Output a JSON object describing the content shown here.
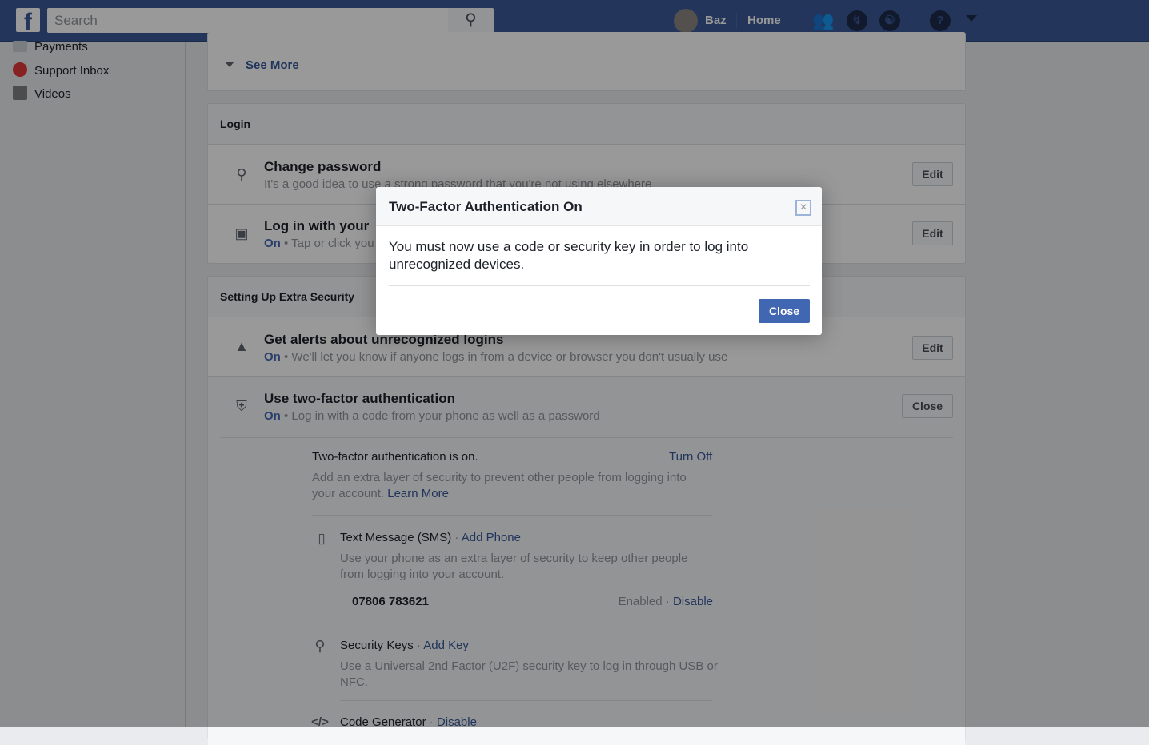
{
  "topbar": {
    "search_placeholder": "Search",
    "user": "Baz",
    "home": "Home",
    "icons": [
      "friends-icon",
      "messenger-icon",
      "globe-icon",
      "help-icon",
      "caret-down-icon"
    ]
  },
  "sidebar": {
    "items": [
      {
        "label": "Payments",
        "icon": "credit-card-icon"
      },
      {
        "label": "Support Inbox",
        "icon": "lifebuoy-icon"
      },
      {
        "label": "Videos",
        "icon": "film-icon"
      }
    ]
  },
  "main": {
    "see_more": "See More",
    "login": {
      "header": "Login",
      "rows": [
        {
          "title": "Change password",
          "sub": "It's a good idea to use a strong password that you're not using elsewhere",
          "button": "Edit",
          "icon": "key-icon"
        },
        {
          "title": "Log in with your",
          "on": "On",
          "sub": " • Tap or click you",
          "button": "Edit",
          "icon": "profile-picture-icon"
        }
      ]
    },
    "extra": {
      "header": "Setting Up Extra Security",
      "rows": [
        {
          "title": "Get alerts about unrecognized logins",
          "on": "On",
          "sub": " • We'll let you know if anyone logs in from a device or browser you don't usually use",
          "button": "Edit",
          "icon": "bell-icon"
        },
        {
          "title": "Use two-factor authentication",
          "on": "On",
          "sub": " • Log in with a code from your phone as well as a password",
          "button": "Close",
          "icon": "shield-icon"
        }
      ]
    },
    "tfa": {
      "status": "Two-factor authentication is on.",
      "turn_off": "Turn Off",
      "desc": "Add an extra layer of security to prevent other people from logging into your account.",
      "learn_more": "Learn More",
      "sms": {
        "title": "Text Message (SMS)",
        "dot": " · ",
        "action": "Add Phone",
        "desc": "Use your phone as an extra layer of security to keep other people from logging into your account.",
        "phone": "07806 783621",
        "enabled": "Enabled",
        "disable": "Disable"
      },
      "keys": {
        "title": "Security Keys",
        "dot": " · ",
        "action": "Add Key",
        "desc": "Use a Universal 2nd Factor (U2F) security key to log in through USB or NFC."
      },
      "codegen": {
        "title": "Code Generator",
        "dot": " · ",
        "action": "Disable"
      }
    }
  },
  "dialog": {
    "title": "Two-Factor Authentication On",
    "body": "You must now use a code or security key in order to log into unrecognized devices.",
    "close": "Close"
  }
}
